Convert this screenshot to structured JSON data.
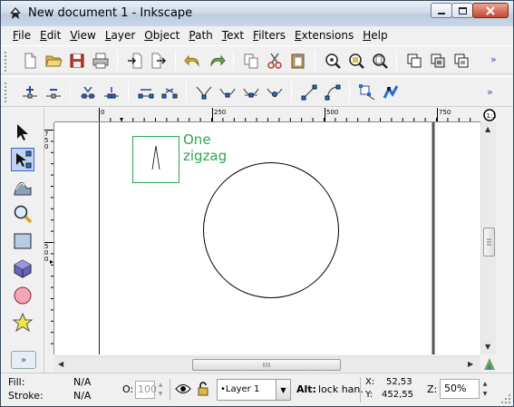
{
  "window": {
    "title": "New document 1 - Inkscape"
  },
  "menu": [
    "File",
    "Edit",
    "View",
    "Layer",
    "Object",
    "Path",
    "Text",
    "Filters",
    "Extensions",
    "Help"
  ],
  "toolbar_more": "»",
  "ruler_h_labels": [
    "0",
    "250",
    "500",
    "750"
  ],
  "ruler_v_labels": [
    "750",
    "500"
  ],
  "canvas": {
    "text_line1": "One",
    "text_line2": "zigzag",
    "text_color": "#2ea44f"
  },
  "status": {
    "fill_label": "Fill:",
    "fill_value": "N/A",
    "stroke_label": "Stroke:",
    "stroke_value": "N/A",
    "opacity_label": "O:",
    "opacity_value": "100",
    "layer_name": "•Layer 1",
    "message_key": "Alt:",
    "message_text": "lock han.",
    "x_label": "X:",
    "x_value": "52,53",
    "y_label": "Y:",
    "y_value": "452,55",
    "zoom_label": "Z:",
    "zoom_value": "50%"
  },
  "accent": "#316ac5"
}
